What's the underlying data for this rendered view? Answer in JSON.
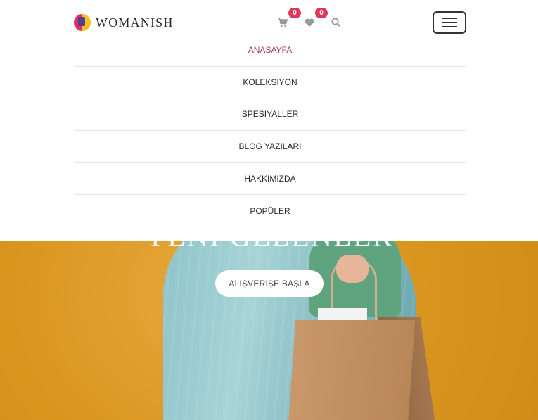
{
  "brand": {
    "name": "WOMANISH"
  },
  "header": {
    "cart_count": "0",
    "wishlist_count": "0"
  },
  "icons": {
    "cart": "shopping-cart-icon",
    "wishlist": "heart-icon",
    "search": "search-icon",
    "menu": "hamburger-menu-icon"
  },
  "nav": {
    "items": [
      {
        "label": "ANASAYFA",
        "active": true
      },
      {
        "label": "KOLEKSIYON"
      },
      {
        "label": "SPESIYALLER"
      },
      {
        "label": "BLOG YAZILARI"
      },
      {
        "label": "HAKKIMIZDA"
      },
      {
        "label": "POPÜLER"
      }
    ]
  },
  "hero": {
    "title": "YENI GELENLER",
    "cta_label": "ALIŞVERIŞE BAŞLA"
  },
  "colors": {
    "accent": "#a73d62",
    "badge": "#e0365c",
    "hero_background": "#d8961f"
  }
}
